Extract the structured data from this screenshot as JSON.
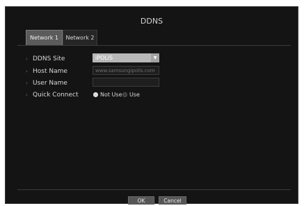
{
  "dialog": {
    "title": "DDNS"
  },
  "tabs": [
    {
      "label": "Network 1"
    },
    {
      "label": "Network 2"
    }
  ],
  "fields": {
    "ddns_site": {
      "label": "DDNS Site",
      "value": "iPOLiS"
    },
    "host_name": {
      "label": "Host Name",
      "placeholder": "www.samsungipolis.com",
      "value": ""
    },
    "user_name": {
      "label": "User Name",
      "value": ""
    },
    "quick_connect": {
      "label": "Quick Connect",
      "options": [
        "Not Use",
        "Use"
      ],
      "selected": "Not Use"
    }
  },
  "buttons": {
    "ok": "OK",
    "cancel": "Cancel"
  },
  "icons": {
    "dropdown": "chevron-down-icon",
    "bullet": "bullet-arrow-icon"
  }
}
